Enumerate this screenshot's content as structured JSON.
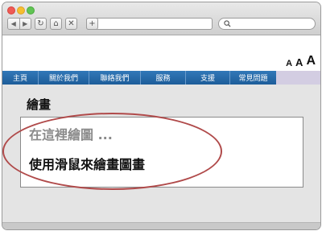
{
  "browser": {
    "back_icon": "back-arrow-icon",
    "forward_icon": "forward-arrow-icon",
    "reload_glyph": "↻",
    "home_glyph": "⌂",
    "stop_glyph": "✕",
    "add_glyph": "+",
    "url_value": "",
    "search_value": ""
  },
  "font_sizer": {
    "small": "A",
    "medium": "A",
    "large": "A"
  },
  "nav": {
    "items": [
      {
        "label": "主頁"
      },
      {
        "label": "關於我們"
      },
      {
        "label": "聯絡我們"
      },
      {
        "label": "服務"
      },
      {
        "label": "支援"
      },
      {
        "label": "常見問題"
      }
    ]
  },
  "main": {
    "title": "繪畫",
    "canvas_placeholder": "在這裡繪圖 ...",
    "canvas_instruction": "使用滑鼠來繪畫圖畫"
  },
  "colors": {
    "nav_blue": "#2a6cab",
    "nav_lavender": "#d3cde2",
    "annotation_red": "#b04a4a"
  }
}
